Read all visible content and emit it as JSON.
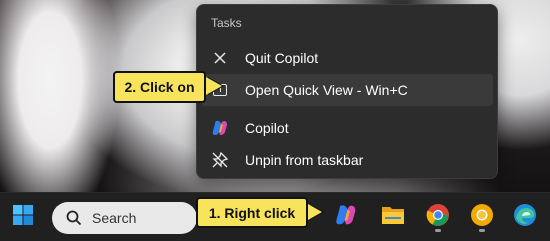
{
  "menu": {
    "header": "Tasks",
    "items": [
      {
        "icon": "close-icon",
        "label": "Quit Copilot"
      },
      {
        "icon": "quick-view-icon",
        "label": "Open Quick View - Win+C"
      },
      {
        "icon": "copilot-icon",
        "label": "Copilot"
      },
      {
        "icon": "unpin-icon",
        "label": "Unpin from taskbar"
      }
    ]
  },
  "callouts": {
    "step1": "1. Right click",
    "step2": "2. Click on"
  },
  "taskbar": {
    "search_label": "Search",
    "apps": [
      "start-icon",
      "copilot-icon",
      "file-explorer-icon",
      "chrome-icon",
      "chrome-canary-icon",
      "edge-icon"
    ]
  },
  "colors": {
    "callout": "#f7e35c",
    "menu_bg": "#2c2c2c",
    "taskbar_bg": "#202020"
  }
}
